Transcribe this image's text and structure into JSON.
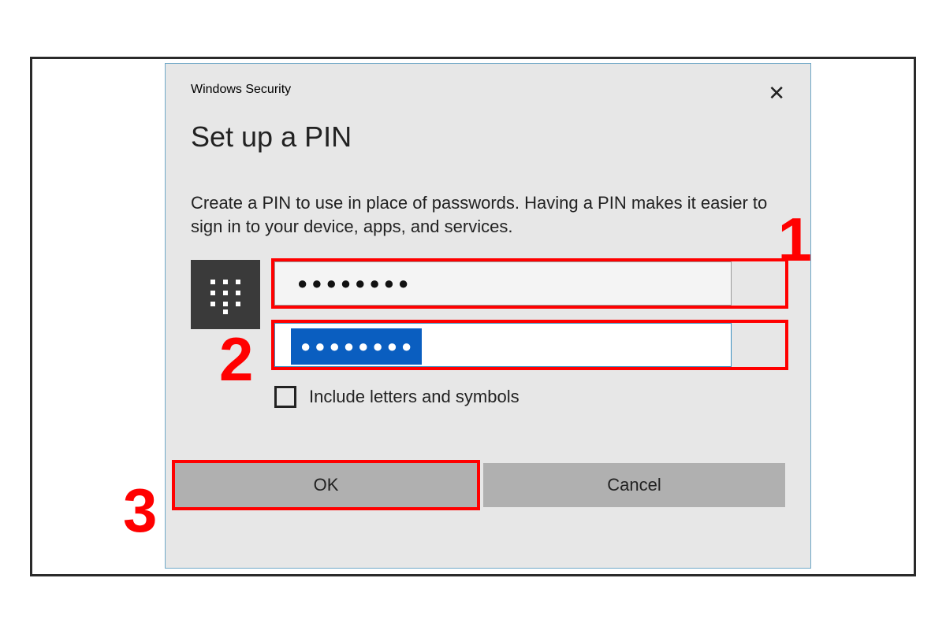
{
  "dialog": {
    "titlebar": "Windows Security",
    "heading": "Set up a PIN",
    "description": "Create a PIN to use in place of passwords. Having a PIN makes it easier to sign in to your device, apps, and services.",
    "pin_masked": "●●●●●●●●",
    "confirm_masked": "●●●●●●●●",
    "checkbox_label": "Include letters and symbols",
    "ok_label": "OK",
    "cancel_label": "Cancel"
  },
  "annotations": {
    "step1": "1",
    "step2": "2",
    "step3": "3"
  }
}
